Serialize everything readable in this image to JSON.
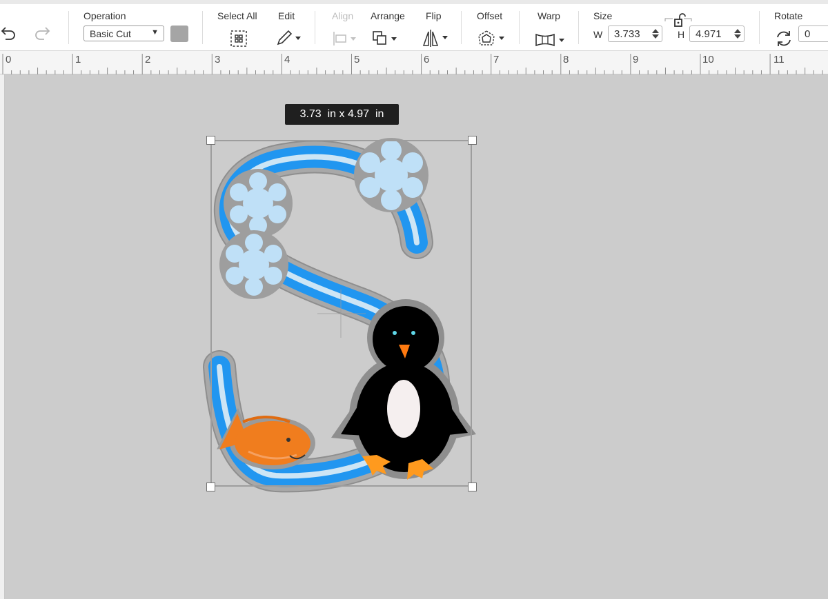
{
  "toolbar": {
    "operation": {
      "label": "Operation",
      "value": "Basic Cut",
      "color": "#a5a5a5"
    },
    "select_all": "Select All",
    "edit": "Edit",
    "align": "Align",
    "arrange": "Arrange",
    "flip": "Flip",
    "offset": "Offset",
    "warp": "Warp",
    "size": {
      "label": "Size",
      "w_label": "W",
      "w_value": "3.733",
      "h_label": "H",
      "h_value": "4.971"
    },
    "rotate": {
      "label": "Rotate",
      "value": "0"
    }
  },
  "ruler": {
    "marks": [
      "0",
      "1",
      "2",
      "3",
      "4",
      "5",
      "6",
      "7",
      "8",
      "9",
      "10",
      "11"
    ]
  },
  "canvas": {
    "size_tooltip": "3.73  in x 4.97  in",
    "background": "#cccccc",
    "letter_color": "#2196f0",
    "snowflake_color": "#bfe0f7",
    "fish_color": "#f07d1e",
    "penguin_color": "#000000"
  }
}
